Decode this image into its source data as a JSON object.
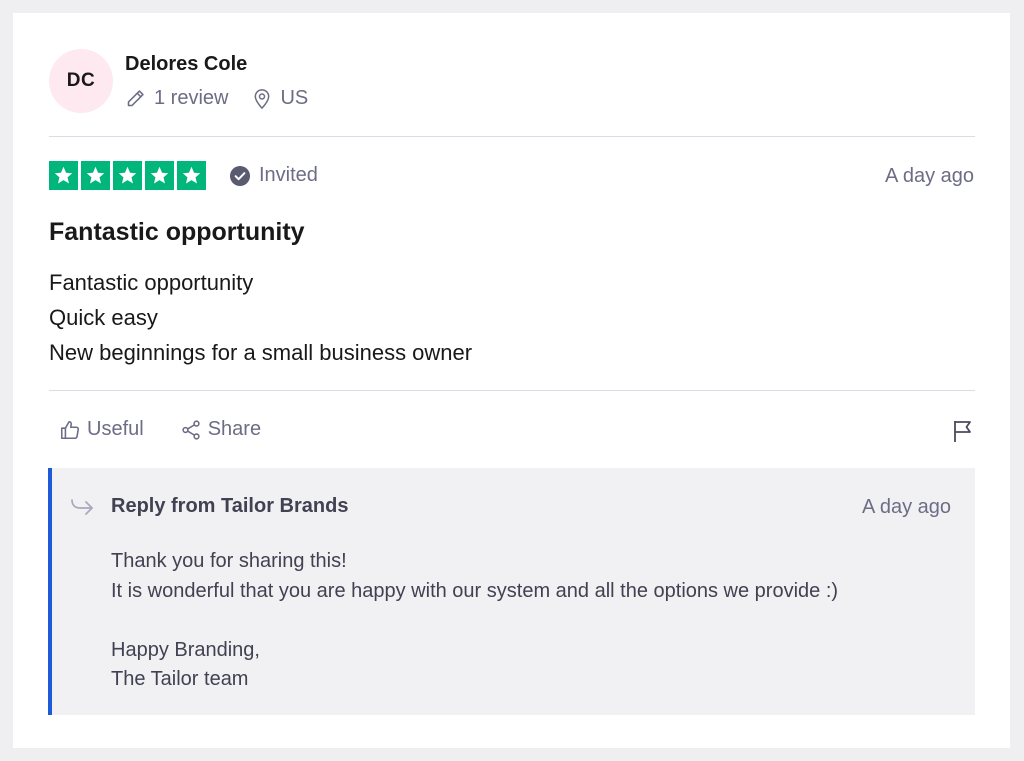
{
  "reviewer": {
    "initials": "DC",
    "name": "Delores Cole",
    "review_count": "1 review",
    "country": "US"
  },
  "review": {
    "rating": 5,
    "rating_max": 5,
    "invited_label": "Invited",
    "date": "A day ago",
    "title": "Fantastic opportunity",
    "body_lines": [
      "Fantastic opportunity",
      "Quick easy",
      "New beginnings for a small business owner"
    ]
  },
  "actions": {
    "useful_label": "Useful",
    "share_label": "Share"
  },
  "reply": {
    "from": "Reply from Tailor Brands",
    "date": "A day ago",
    "lines": [
      "Thank you for sharing this!",
      "It is wonderful that you are happy with our system and all the options we provide :)",
      "",
      "Happy Branding,",
      "The Tailor team"
    ]
  },
  "colors": {
    "star_green": "#00b67a",
    "reply_accent": "#1c5ad9",
    "avatar_bg": "#fde9ef",
    "muted_text": "#6c6c85"
  },
  "icons": [
    "pencil-icon",
    "location-pin-icon",
    "star-icon",
    "verified-check-icon",
    "thumbs-up-icon",
    "share-icon",
    "flag-icon",
    "reply-arrow-icon"
  ]
}
